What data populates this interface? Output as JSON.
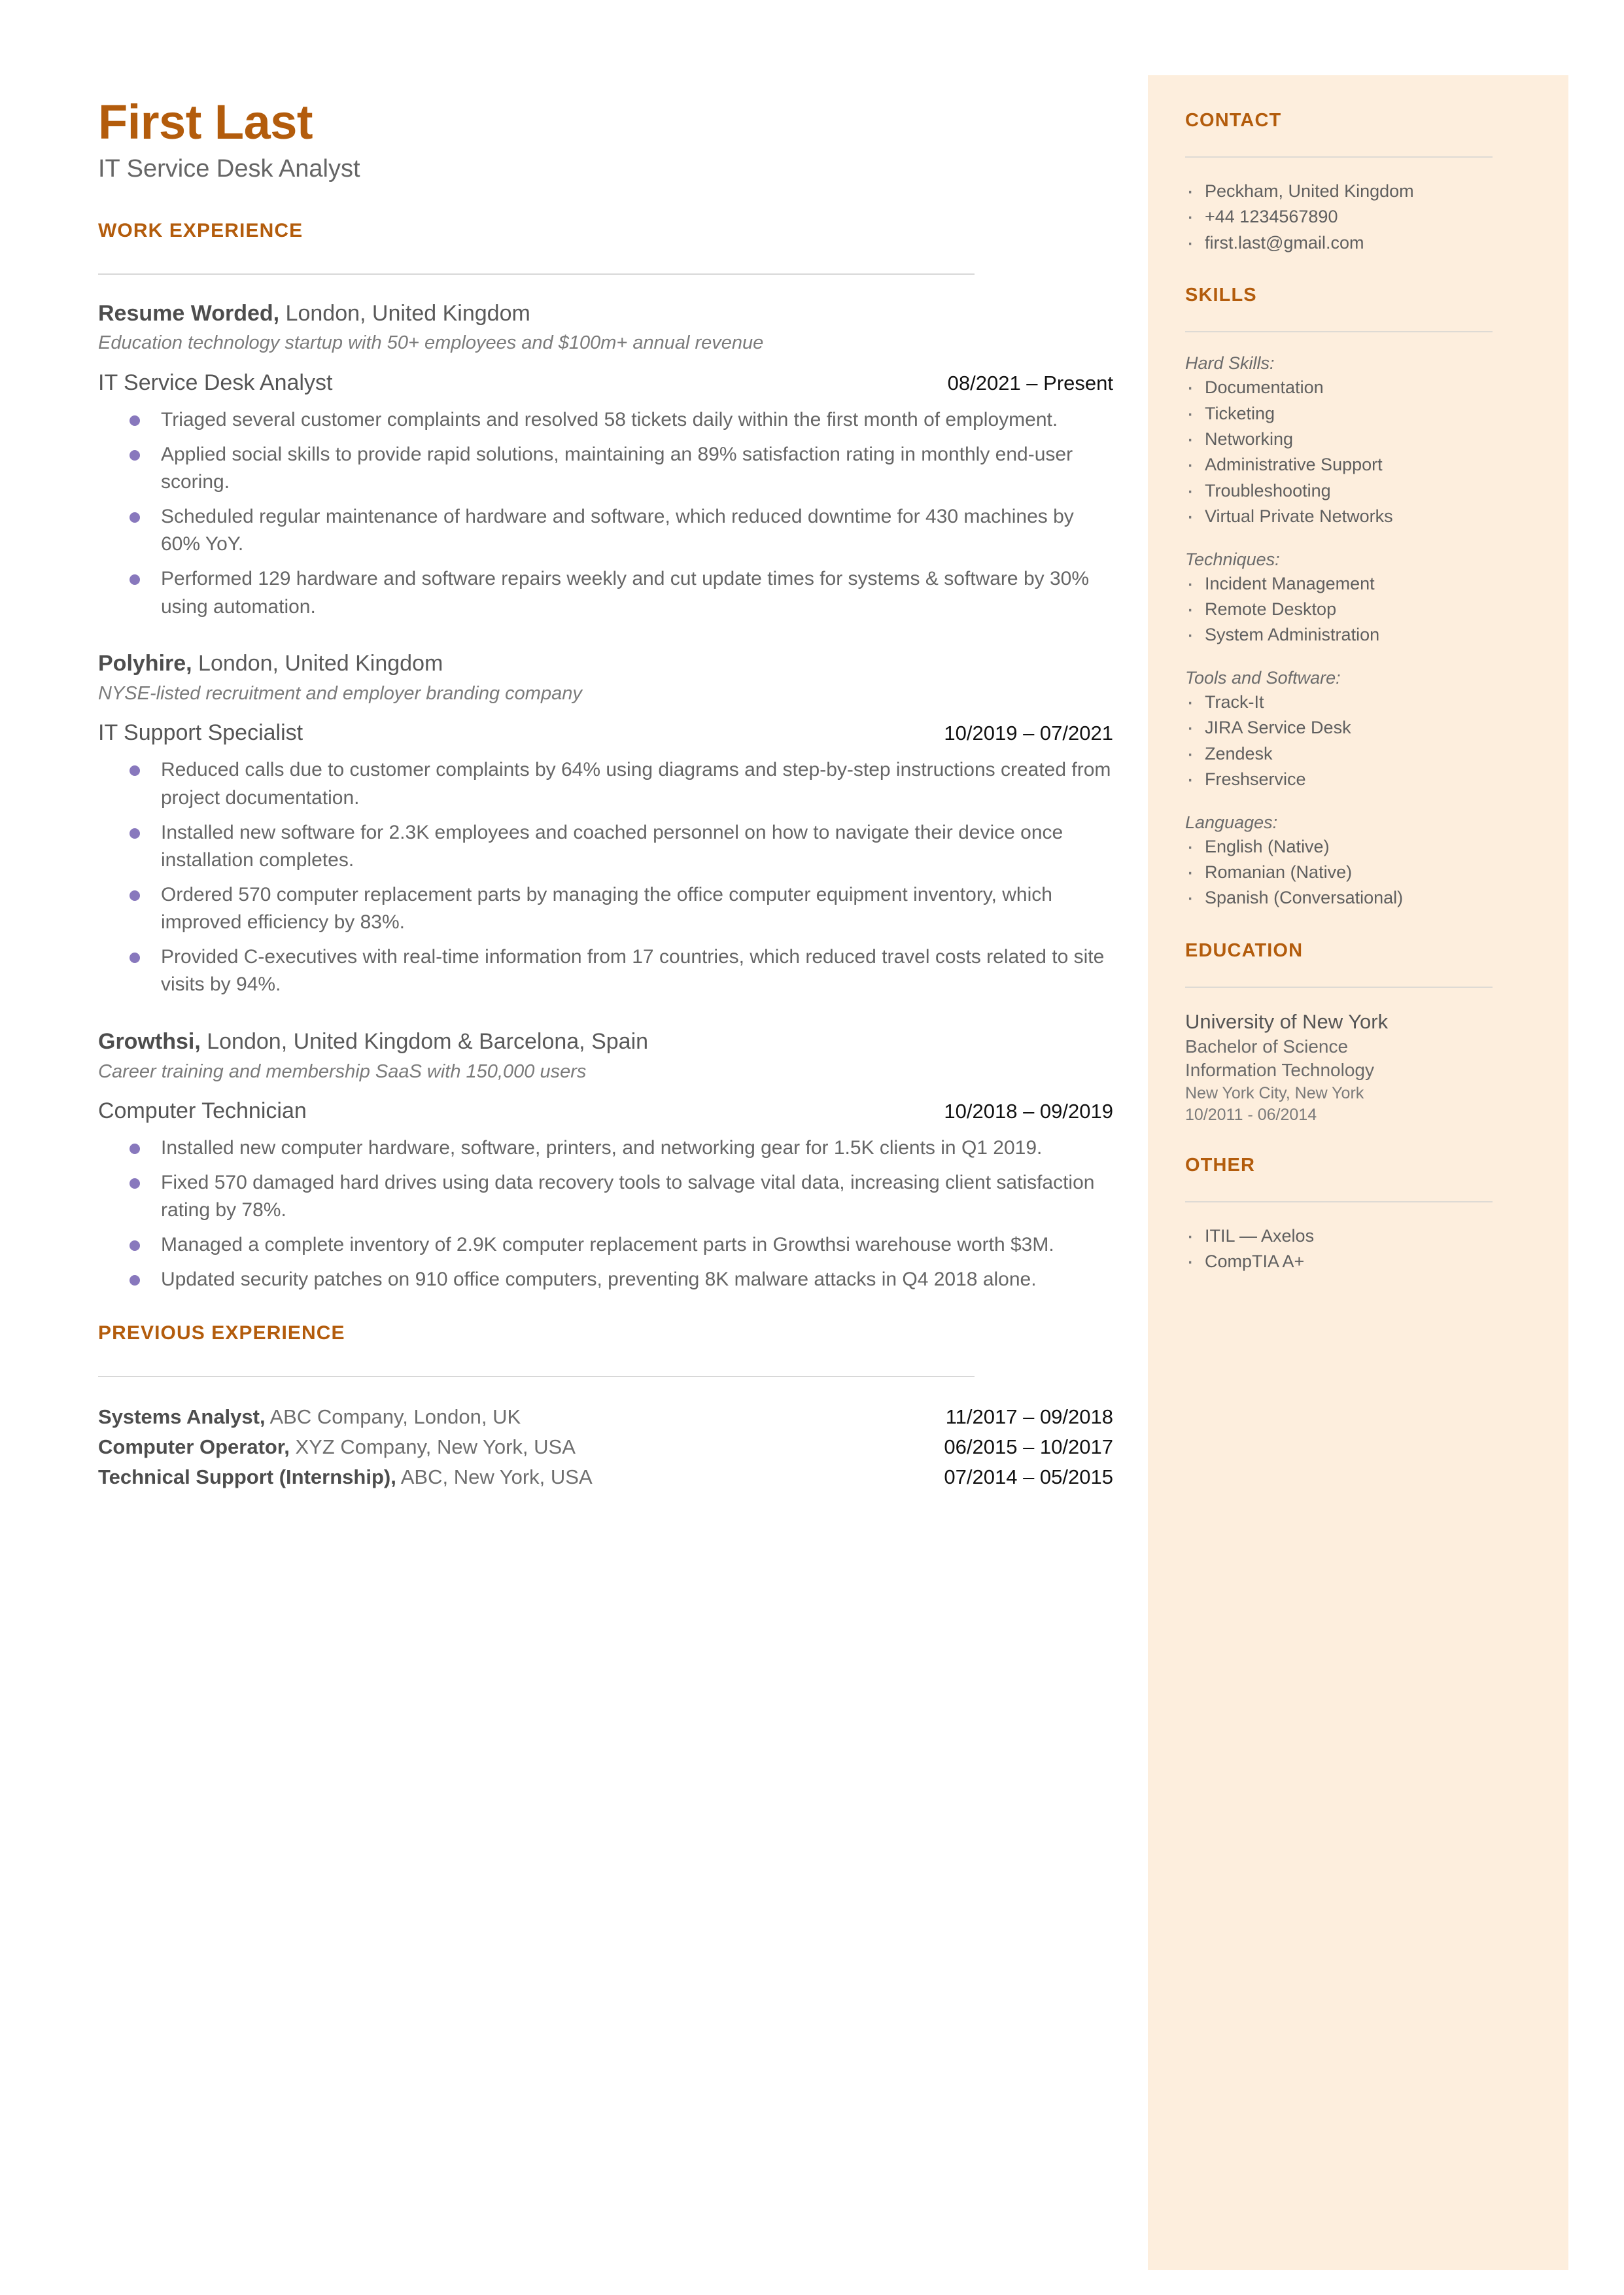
{
  "colors": {
    "accent": "#b35c0c",
    "sidebar_bg": "#fdeedd",
    "bullet": "#8878bd",
    "body_text": "#666666",
    "date_text": "#111111"
  },
  "header": {
    "name": "First Last",
    "job_title": "IT Service Desk Analyst"
  },
  "work_experience": {
    "heading": "WORK EXPERIENCE",
    "jobs": [
      {
        "company": "Resume Worded,",
        "location": "London, United Kingdom",
        "description": "Education technology startup with 50+ employees and $100m+ annual revenue",
        "role": "IT Service Desk Analyst",
        "dates": "08/2021 – Present",
        "bullets": [
          "Triaged several customer complaints and resolved 58 tickets daily within the first month of employment.",
          "Applied social skills to provide rapid solutions, maintaining an 89% satisfaction rating in monthly end-user scoring.",
          "Scheduled regular maintenance of hardware and software, which reduced downtime for 430 machines by 60% YoY.",
          "Performed 129 hardware and software repairs weekly and cut update times for systems & software by 30% using automation."
        ]
      },
      {
        "company": "Polyhire,",
        "location": "London, United Kingdom",
        "description": "NYSE-listed recruitment and employer branding company",
        "role": "IT Support Specialist",
        "dates": "10/2019 – 07/2021",
        "bullets": [
          "Reduced calls due to customer complaints by 64% using diagrams and step-by-step instructions created from project documentation.",
          "Installed new software for 2.3K employees and coached personnel on how to navigate their device once installation completes.",
          "Ordered 570 computer replacement parts by managing the office computer equipment inventory, which improved efficiency by 83%.",
          "Provided C-executives with real-time information from 17 countries, which reduced travel costs related to site visits by 94%."
        ]
      },
      {
        "company": "Growthsi,",
        "location": "London, United Kingdom & Barcelona, Spain",
        "description": "Career training and membership SaaS with 150,000 users",
        "role": "Computer Technician",
        "dates": "10/2018 – 09/2019",
        "bullets": [
          "Installed new computer hardware, software, printers, and networking gear for 1.5K clients in Q1 2019.",
          "Fixed 570 damaged hard drives using data recovery tools to salvage vital data, increasing client satisfaction rating by 78%.",
          "Managed a complete inventory of 2.9K computer replacement parts in Growthsi warehouse worth $3M.",
          "Updated security patches on 910 office computers, preventing 8K malware attacks in Q4 2018 alone."
        ]
      }
    ]
  },
  "previous_experience": {
    "heading": "PREVIOUS EXPERIENCE",
    "rows": [
      {
        "title": "Systems Analyst,",
        "detail": " ABC Company, London, UK",
        "dates": "11/2017 – 09/2018"
      },
      {
        "title": "Computer Operator,",
        "detail": " XYZ Company, New York, USA",
        "dates": "06/2015 – 10/2017"
      },
      {
        "title": "Technical Support (Internship),",
        "detail": " ABC, New York, USA",
        "dates": "07/2014 – 05/2015"
      }
    ]
  },
  "contact": {
    "heading": "CONTACT",
    "items": [
      "Peckham, United Kingdom",
      "+44 1234567890",
      "first.last@gmail.com"
    ]
  },
  "skills": {
    "heading": "SKILLS",
    "groups": [
      {
        "label": "Hard Skills:",
        "items": [
          "Documentation",
          "Ticketing",
          "Networking",
          "Administrative Support",
          "Troubleshooting",
          "Virtual Private Networks"
        ]
      },
      {
        "label": "Techniques:",
        "items": [
          "Incident Management",
          "Remote Desktop",
          "System Administration"
        ]
      },
      {
        "label": "Tools and Software:",
        "items": [
          "Track-It",
          "JIRA Service Desk",
          "Zendesk",
          "Freshservice"
        ]
      },
      {
        "label": "Languages:",
        "items": [
          "English (Native)",
          "Romanian (Native)",
          "Spanish (Conversational)"
        ]
      }
    ]
  },
  "education": {
    "heading": "EDUCATION",
    "school": "University of New York",
    "degree": "Bachelor of Science",
    "field": "Information Technology",
    "location": "New York City, New York",
    "dates": "10/2011 - 06/2014"
  },
  "other": {
    "heading": "OTHER",
    "items": [
      "ITIL — Axelos",
      "CompTIA A+"
    ]
  }
}
